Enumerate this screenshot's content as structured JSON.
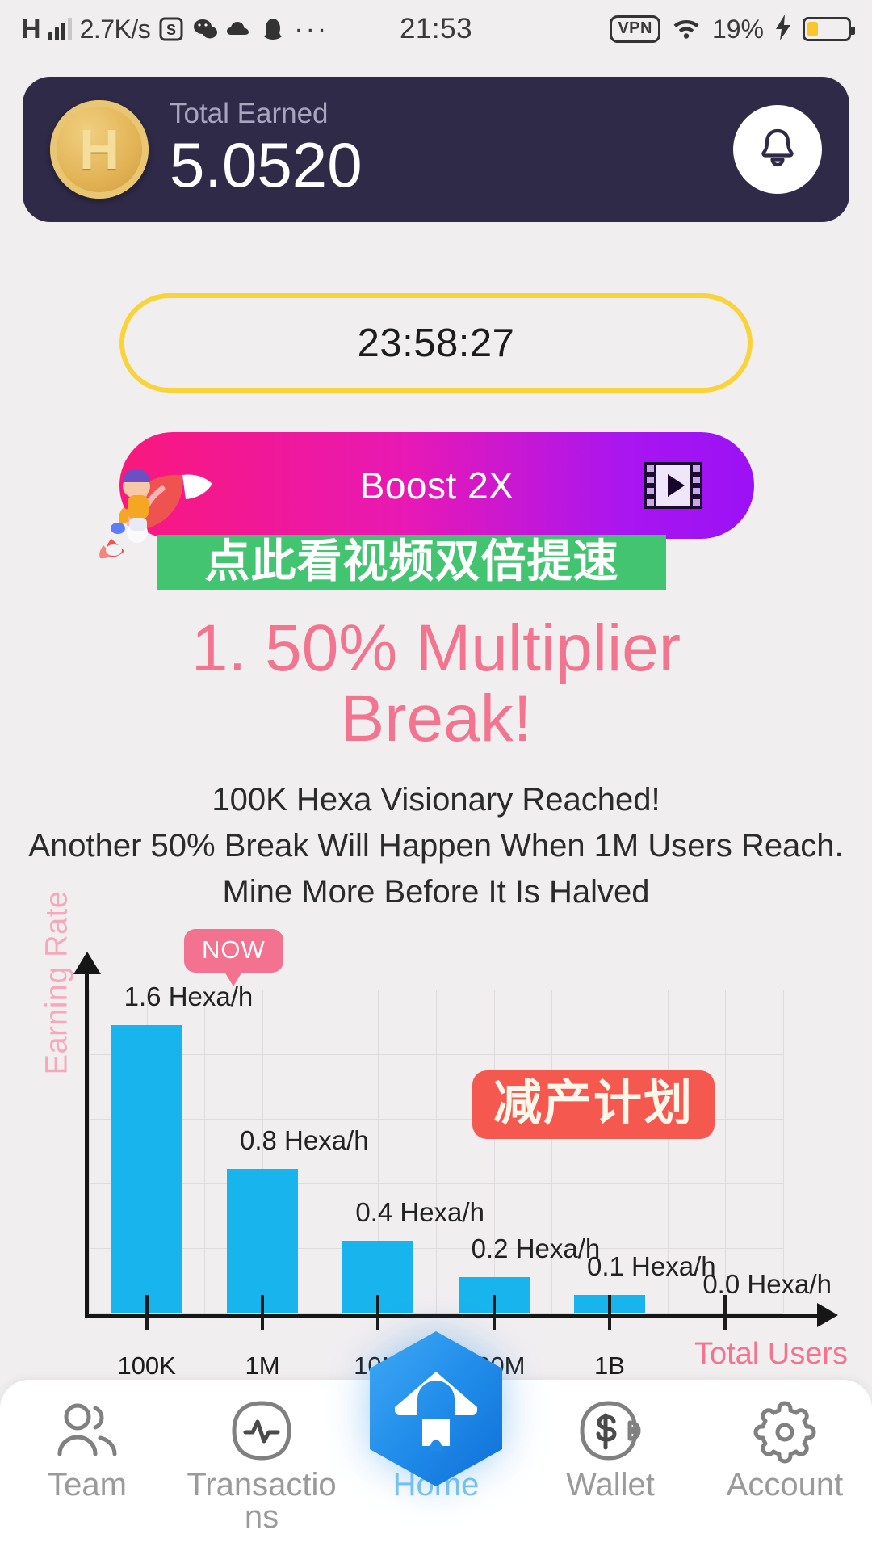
{
  "statusbar": {
    "signal_letter": "H",
    "network_speed": "2.7K/s",
    "app_icons": [
      "s-app-icon",
      "wechat-icon",
      "qq-cloud-icon",
      "qq-penguin-icon"
    ],
    "overflow": "···",
    "time": "21:53",
    "vpn": "VPN",
    "wifi": "wifi-icon",
    "battery_percent": "19%",
    "charging": true
  },
  "earn_card": {
    "coin_symbol": "H",
    "label": "Total Earned",
    "value": "5.0520",
    "bell": "bell-icon",
    "bg_color": "#2e2a48"
  },
  "timer": {
    "value": "23:58:27",
    "border_color": "#fad33b"
  },
  "boost": {
    "label": "Boost 2X",
    "video_icon": "video-film-icon",
    "cta_text": "点此看视频双倍提速",
    "cta_bg": "#43c470",
    "gradient_from": "#f9187c",
    "gradient_to": "#9b11f5"
  },
  "announcement": {
    "headline_line1": "1. 50% Multiplier",
    "headline_line2": "Break!",
    "headline_color": "#f2748f",
    "lines": [
      "100K Hexa Visionary Reached!",
      "Another 50% Break Will Happen When 1M Users Reach.",
      "Mine More Before It Is Halved"
    ]
  },
  "chart_data": {
    "type": "bar",
    "title": "",
    "xlabel": "Total Users",
    "ylabel": "Earning Rate",
    "categories": [
      "100K",
      "1M",
      "10M",
      "100M",
      "1B",
      ""
    ],
    "values": [
      1.6,
      0.8,
      0.4,
      0.2,
      0.1,
      0.0
    ],
    "value_labels": [
      "1.6 Hexa/h",
      "0.8 Hexa/h",
      "0.4 Hexa/h",
      "0.2 Hexa/h",
      "0.1 Hexa/h",
      "0.0 Hexa/h"
    ],
    "unit": "Hexa/h",
    "ylim": [
      0,
      1.8
    ],
    "grid": true,
    "bar_color": "#18b4ee",
    "axis_label_color": "#f2748f",
    "annotations": [
      {
        "name": "now-badge",
        "text": "NOW",
        "bg": "#f3728f",
        "target_category": "100K"
      },
      {
        "name": "reduction-plan-badge",
        "text": "减产计划",
        "bg": "#f4584e"
      }
    ]
  },
  "bottomnav": {
    "items": [
      {
        "id": "team",
        "label": "Team",
        "icon": "people-icon",
        "active": false
      },
      {
        "id": "transactions",
        "label": "Transactions",
        "icon": "activity-pulse-icon",
        "active": false
      },
      {
        "id": "home",
        "label": "Home",
        "icon": "home-hexagon-icon",
        "active": true
      },
      {
        "id": "wallet",
        "label": "Wallet",
        "icon": "wallet-dollar-icon",
        "active": false
      },
      {
        "id": "account",
        "label": "Account",
        "icon": "gear-icon",
        "active": false
      }
    ],
    "active_color": "#7dc6ee",
    "inactive_color": "#9a9a9a"
  }
}
